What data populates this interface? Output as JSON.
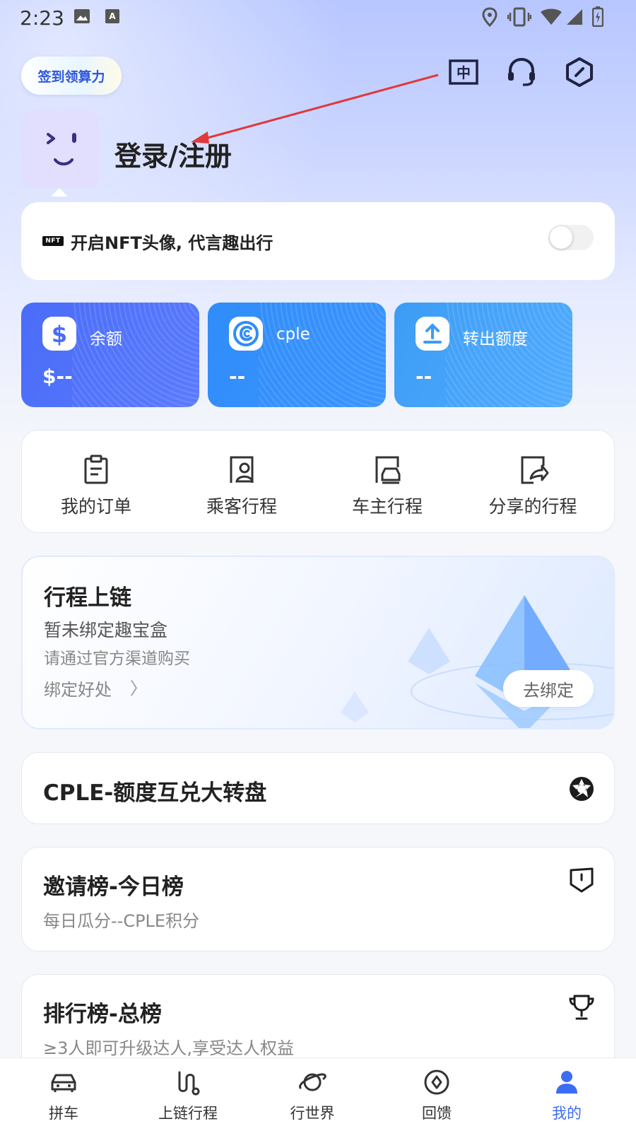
{
  "status_bar": {
    "time": "2:23",
    "icons": [
      "image-icon",
      "text-icon",
      "location-icon",
      "vibrate-icon",
      "wifi-icon",
      "signal-icon",
      "battery-icon"
    ]
  },
  "header": {
    "checkin_label": "签到领算力",
    "icons": [
      "language-zh-icon",
      "headset-icon",
      "settings-hex-icon"
    ],
    "language_icon_text": "中"
  },
  "profile": {
    "login_label": "登录/注册"
  },
  "nft_banner": {
    "badge": "NFT",
    "text": "开启NFT头像, 代言趣出行",
    "toggle_on": false
  },
  "balances": [
    {
      "label": "余额",
      "value": "$--",
      "icon": "dollar-icon",
      "color": "#4a6cf7"
    },
    {
      "label": "cple",
      "value": "--",
      "icon": "cple-coin-icon",
      "color": "#2f8cf9"
    },
    {
      "label": "转出额度",
      "value": "--",
      "icon": "upload-icon",
      "color": "#3fa0f6"
    }
  ],
  "quick_menu": [
    {
      "label": "我的订单",
      "icon": "order-icon"
    },
    {
      "label": "乘客行程",
      "icon": "passenger-trip-icon"
    },
    {
      "label": "车主行程",
      "icon": "driver-trip-icon"
    },
    {
      "label": "分享的行程",
      "icon": "share-trip-icon"
    }
  ],
  "chain_card": {
    "title": "行程上链",
    "subtitle": "暂未绑定趣宝盒",
    "hint": "请通过官方渠道购买",
    "link": "绑定好处",
    "link_arrow": "〉",
    "button": "去绑定"
  },
  "list_cards": [
    {
      "title": "CPLE-额度互兑大转盘",
      "subtitle": "",
      "icon": "wheel-icon"
    },
    {
      "title": "邀请榜-今日榜",
      "subtitle": "每日瓜分--CPLE积分",
      "icon": "shield-badge-icon"
    },
    {
      "title": "排行榜-总榜",
      "subtitle": "≥3人即可升级达人,享受达人权益",
      "icon": "trophy-icon"
    }
  ],
  "bottom_nav": [
    {
      "label": "拼车",
      "icon": "car-icon",
      "active": false
    },
    {
      "label": "上链行程",
      "icon": "route-icon",
      "active": false
    },
    {
      "label": "行世界",
      "icon": "planet-icon",
      "active": false
    },
    {
      "label": "回馈",
      "icon": "compass-icon",
      "active": false
    },
    {
      "label": "我的",
      "icon": "person-icon",
      "active": true
    }
  ],
  "colors": {
    "accent": "#3d6cf4",
    "annotation_arrow": "#e0383b"
  }
}
